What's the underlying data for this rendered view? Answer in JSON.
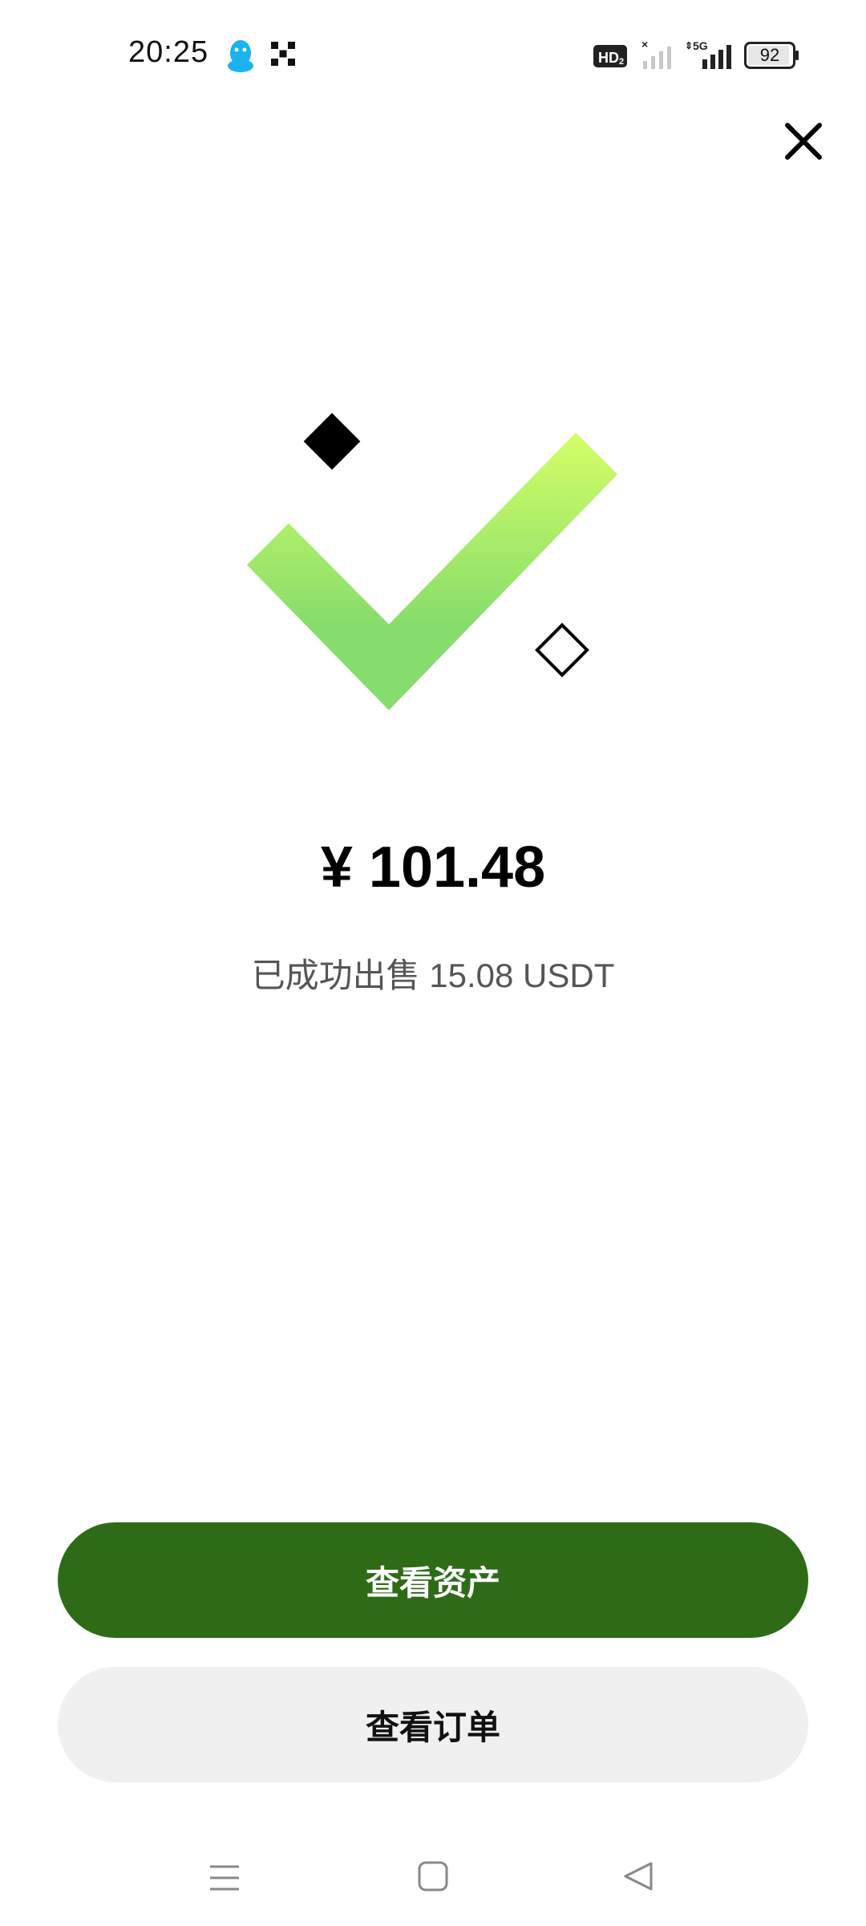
{
  "status_bar": {
    "time": "20:25",
    "hd_label": "HD2",
    "network_label": "5G",
    "battery_level": "92"
  },
  "result": {
    "amount": "¥ 101.48",
    "message": "已成功出售 15.08 USDT"
  },
  "actions": {
    "view_assets": "查看资产",
    "view_orders": "查看订单"
  },
  "colors": {
    "primary_button": "#2e6b17",
    "secondary_button": "#f0f0f0",
    "check_gradient_top": "#d4ff66",
    "check_gradient_bottom": "#86dc6c"
  },
  "icons": {
    "close": "close-icon",
    "success": "checkmark-icon",
    "nav_menu": "menu-icon",
    "nav_home": "home-icon",
    "nav_back": "back-icon"
  }
}
